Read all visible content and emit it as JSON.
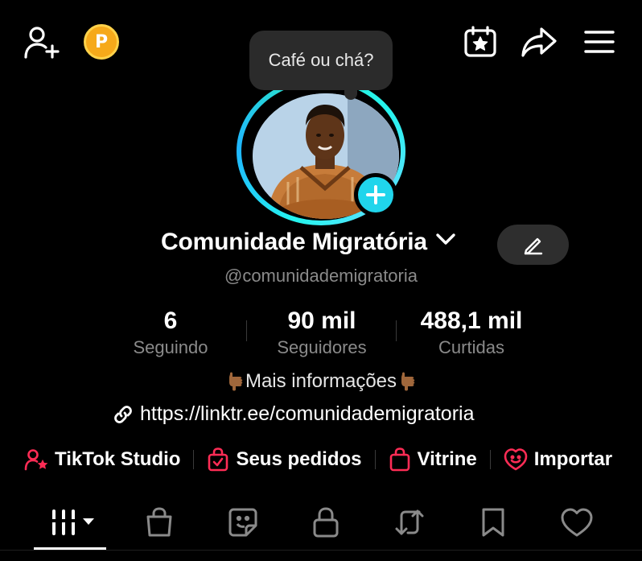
{
  "tooltip": {
    "text": "Café ou chá?"
  },
  "profile": {
    "name": "Comunidade Migratória",
    "handle": "@comunidademigratoria",
    "bio": "Mais informações",
    "link": "https://linktr.ee/comunidademigratoria"
  },
  "stats": [
    {
      "value": "6",
      "label": "Seguindo"
    },
    {
      "value": "90 mil",
      "label": "Seguidores"
    },
    {
      "value": "488,1 mil",
      "label": "Curtidas"
    }
  ],
  "shortcuts": [
    {
      "label": "TikTok Studio",
      "icon": "user-star-icon"
    },
    {
      "label": "Seus pedidos",
      "icon": "bag-check-icon"
    },
    {
      "label": "Vitrine",
      "icon": "shopping-bag-icon"
    },
    {
      "label": "Importar",
      "icon": "heart-chat-icon"
    }
  ],
  "coin_letter": "P",
  "colors": {
    "accent": "#20d5ec",
    "shortcut_icon": "#fe2c55",
    "coin": "#f6a91a"
  },
  "tabs": [
    "videos-grid-icon",
    "shopping-bag-icon",
    "sticker-icon",
    "lock-icon",
    "repost-icon",
    "bookmark-icon",
    "heart-icon"
  ]
}
